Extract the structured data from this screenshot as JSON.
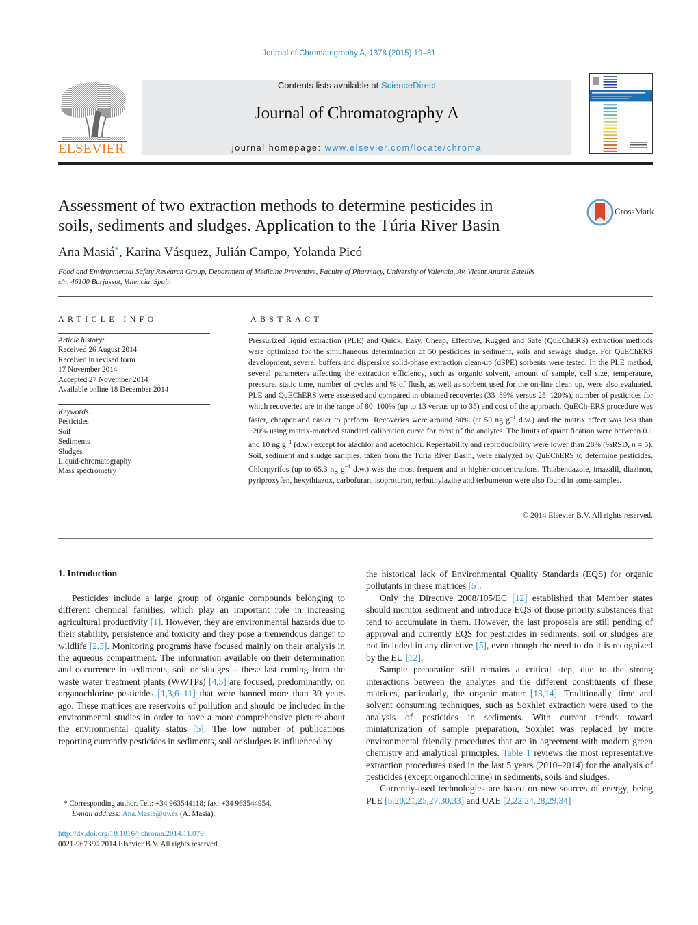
{
  "header": {
    "citation": "Journal of Chromatography A, 1378 (2015) 19–31",
    "contents_prefix": "Contents lists available at ",
    "contents_link": "ScienceDirect",
    "journal_title": "Journal of Chromatography A",
    "homepage_prefix": "journal homepage: ",
    "homepage_link": "www.elsevier.com/locate/chroma",
    "publisher_logo_text": "ELSEVIER",
    "publisher_color": "#f07d1e",
    "link_color": "#2a8fc4"
  },
  "article": {
    "title_line1": "Assessment of two extraction methods to determine pesticides in",
    "title_line2": "soils, sediments and sludges. Application to the Túria River Basin",
    "crossmark_label": "CrossMark",
    "authors": {
      "first": "Ana Masiá",
      "star": "*",
      "rest": ", Karina Vásquez, Julián Campo, Yolanda Picó"
    },
    "affiliation_line1": "Food and Environmental Safety Research Group, Department of Medicine Preventive, Faculty of Pharmacy, University of Valencia, Av. Vicent Andrés Estellés",
    "affiliation_line2": "s/n, 46100 Burjassot, Valencia, Spain"
  },
  "article_info": {
    "heading": "ARTICLE INFO",
    "history_label": "Article history:",
    "history": [
      "Received 26 August 2014",
      "Received in revised form",
      "17 November 2014",
      "Accepted 27 November 2014",
      "Available online 18 December 2014"
    ],
    "keywords_label": "Keywords:",
    "keywords": [
      "Pesticides",
      "Soil",
      "Sediments",
      "Sludges",
      "Liquid-chromatography",
      "Mass spectrometry"
    ]
  },
  "abstract": {
    "heading": "ABSTRACT",
    "p1": "Pressurized liquid extraction (PLE) and Quick, Easy, Cheap, Effective, Rugged and Safe (QuEChERS) extraction methods were optimized for the simultaneous determination of 50 pesticides in sediment, soils and sewage sludge. For QuEChERS development, several buffers and dispersive solid-phase extraction clean-up (dSPE) sorbents were tested. In the PLE method, several parameters affecting the extraction efficiency, such as organic solvent, amount of sample, cell size, temperature, pressure, static time, number of cycles and % of flush, as well as sorbent used for the on-line clean up, were also evaluated. PLE and QuEChERS were assessed and compared in obtained recoveries (33–89% versus 25–120%), number of pesticides for which recoveries are in the range of 80–100% (up to 13 versus up to 35) and cost of the approach. QuECh-ERS procedure was faster, cheaper and easier to perform. Recoveries were around 80% (at 50 ng g",
    "sup1": "−1",
    "p2": " d.w.) and the matrix effect was less than −20% using matrix-matched standard calibration curve for most of the analytes. The limits of quantification were between 0.1 and 10 ng g",
    "sup2": "−1",
    "p3": " (d.w.) except for alachlor and acetochlor. Repeatability and reproducibility were lower than 28% (%RSD, ",
    "n_italic": "n",
    "p4": " = 5). Soil, sediment and sludge samples, taken from the Túria River Basin, were analyzed by QuEChERS to determine pesticides. Chlorpyrifos (up to 65.3 ng g",
    "sup3": "−1",
    "p5": " d.w.) was the most frequent and at higher concentrations. Thiabendazole, imazalil, diazinon, pyriproxyfen, hexythiazox, carbofuran, isoproturon, terbuthylazine and terbumeton were also found in some samples.",
    "copyright": "© 2014 Elsevier B.V. All rights reserved."
  },
  "body": {
    "intro_heading": "1.  Introduction",
    "left_p1": {
      "t1": "Pesticides include a large group of organic compounds belonging to different chemical families, which play an important role in increasing agricultural productivity ",
      "r1": "[1]",
      "t2": ". However, they are environmental hazards due to their stability, persistence and toxicity and they pose a tremendous danger to wildlife ",
      "r2": "[2,3]",
      "t3": ". Monitoring programs have focused mainly on their analysis in the aqueous compartment. The information available on their determination and occurrence in sediments, soil or sludges – these last coming from the waste water treatment plants (WWTPs) ",
      "r3": "[4,5]",
      "t4": " are focused, predominantly, on organochlorine pesticides ",
      "r4": "[1,3,6–11]",
      "t5": " that were banned more than 30 years ago. These matrices are reservoirs of pollution and should be included in the environmental studies in order to have a more comprehensive picture about the environmental quality status ",
      "r5": "[5]",
      "t6": ". The low number of publications reporting currently pesticides in sediments, soil or sludges is influenced by"
    },
    "right_p0": {
      "t1": "the historical lack of Environmental Quality Standards (EQS) for organic pollutants in these matrices ",
      "r1": "[5]",
      "t2": "."
    },
    "right_p1": {
      "t1": "Only the Directive 2008/105/EC ",
      "r1": "[12]",
      "t2": " established that Member states should monitor sediment and introduce EQS of those priority substances that tend to accumulate in them. However, the last proposals are still pending of approval and currently EQS for pesticides in sediments, soil or sludges are not included in any directive ",
      "r2": "[5]",
      "t3": ", even though the need to do it is recognized by the EU ",
      "r3": "[12]",
      "t4": "."
    },
    "right_p2": {
      "t1": "Sample preparation still remains a critical step, due to the strong interactions between the analytes and the different constituents of these matrices, particularly, the organic matter ",
      "r1": "[13,14]",
      "t2": ". Traditionally, time and solvent consuming techniques, such as Soxhlet extraction were used to the analysis of pesticides in sediments. With current trends toward miniaturization of sample preparation, Soxhlet was replaced by more environmental friendly procedures that are in agreement with modern green chemistry and analytical principles. ",
      "r2": "Table 1",
      "t3": " reviews the most representative extraction procedures used in the last 5 years (2010–2014) for the analysis of pesticides (except organochlorine) in sediments, soils and sludges."
    },
    "right_p3": {
      "t1": "Currently-used technologies are based on new sources of energy, being PLE ",
      "r1": "[5,20,21,25,27,30,33]",
      "t2": " and UAE ",
      "r2": "[2,22,24,28,29,34]"
    }
  },
  "footnote": {
    "star": "*",
    "corresponding": " Corresponding author. Tel.: +34 963544118; fax: +34 963544954.",
    "email_label": "E-mail address:",
    "email": "Ana.Masia@uv.es",
    "email_suffix": " (A. Masiá).",
    "doi_link": "http://dx.doi.org/10.1016/j.chroma.2014.11.079",
    "issn": "0021-9673/© 2014 Elsevier B.V. All rights reserved."
  }
}
